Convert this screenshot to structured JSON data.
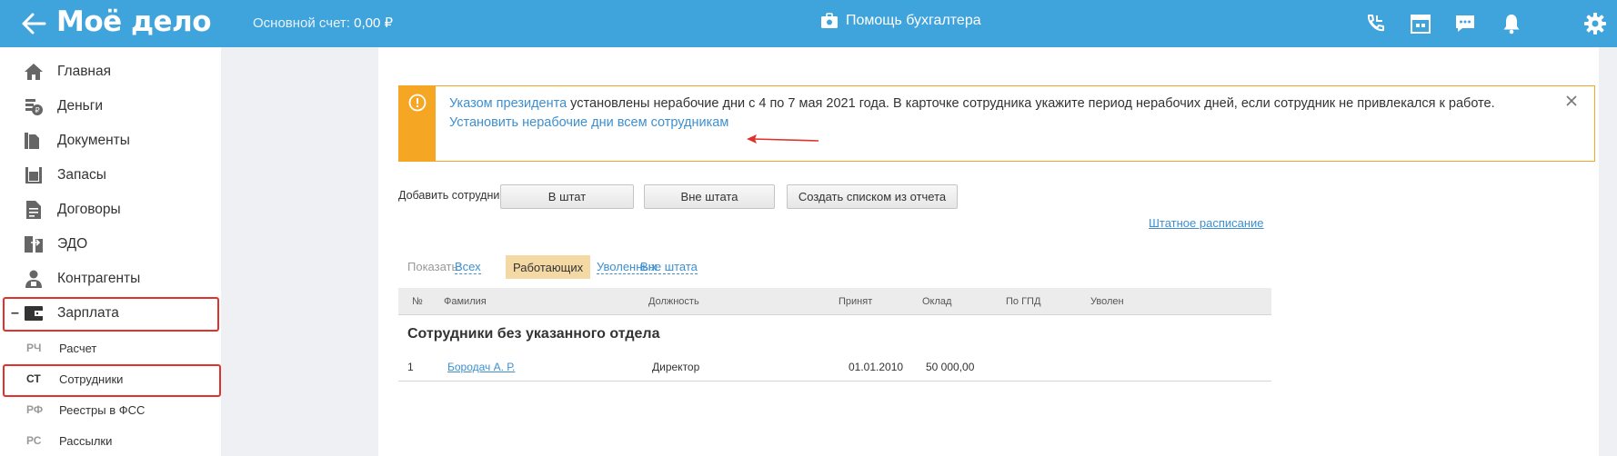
{
  "header": {
    "logo": "Моё дело",
    "account_label": "Основной счет:",
    "account_value": "0,00 ₽",
    "assistant_label": "Помощь бухгалтера",
    "icons": [
      "phone-icon",
      "calendar-icon",
      "chat-icon",
      "bell-icon",
      "gear-icon"
    ]
  },
  "sidebar": {
    "items": [
      {
        "label": "Главная",
        "icon": "home-icon"
      },
      {
        "label": "Деньги",
        "icon": "money-icon"
      },
      {
        "label": "Документы",
        "icon": "documents-icon"
      },
      {
        "label": "Запасы",
        "icon": "stock-icon"
      },
      {
        "label": "Договоры",
        "icon": "contracts-icon"
      },
      {
        "label": "ЭДО",
        "icon": "edo-icon"
      },
      {
        "label": "Контрагенты",
        "icon": "contractors-icon"
      },
      {
        "label": "Зарплата",
        "icon": "wallet-icon",
        "expanded": true
      }
    ],
    "subitems": [
      {
        "abbr": "РЧ",
        "label": "Расчет"
      },
      {
        "abbr": "СТ",
        "label": "Сотрудники",
        "active": true
      },
      {
        "abbr": "РФ",
        "label": "Реестры в ФСС"
      },
      {
        "abbr": "РС",
        "label": "Рассылки"
      }
    ],
    "collapse_symbol": "–"
  },
  "notice": {
    "link1": "Указом президента",
    "text": " установлены нерабочие дни с 4 по 7 мая 2021 года. В карточке сотрудника укажите период нерабочих дней, если сотрудник не привлекался к работе.",
    "link2": "Установить нерабочие дни всем сотрудникам"
  },
  "add_employee": {
    "label": "Добавить сотрудника:",
    "buttons": [
      "В штат",
      "Вне штата",
      "Создать списком из отчета"
    ],
    "staff_schedule_link": "Штатное расписание"
  },
  "filter": {
    "label": "Показать:",
    "options": [
      "Всех",
      "Работающих",
      "Уволенных",
      "Вне штата"
    ],
    "active": "Работающих"
  },
  "table": {
    "columns": [
      "№",
      "Фамилия",
      "Должность",
      "Принят",
      "Оклад",
      "По ГПД",
      "Уволен"
    ],
    "group_title": "Сотрудники без указанного отдела",
    "rows": [
      {
        "num": "1",
        "name": "Бородач А. Р.",
        "position": "Директор",
        "hired": "01.01.2010",
        "salary": "50 000,00",
        "gpd": "",
        "fired": ""
      }
    ]
  },
  "colors": {
    "header_bg": "#3fa3dc",
    "accent_link": "#3d8fd0",
    "warning": "#f5a623",
    "highlight": "#e0312b",
    "active_filter": "#f4d9a5"
  }
}
